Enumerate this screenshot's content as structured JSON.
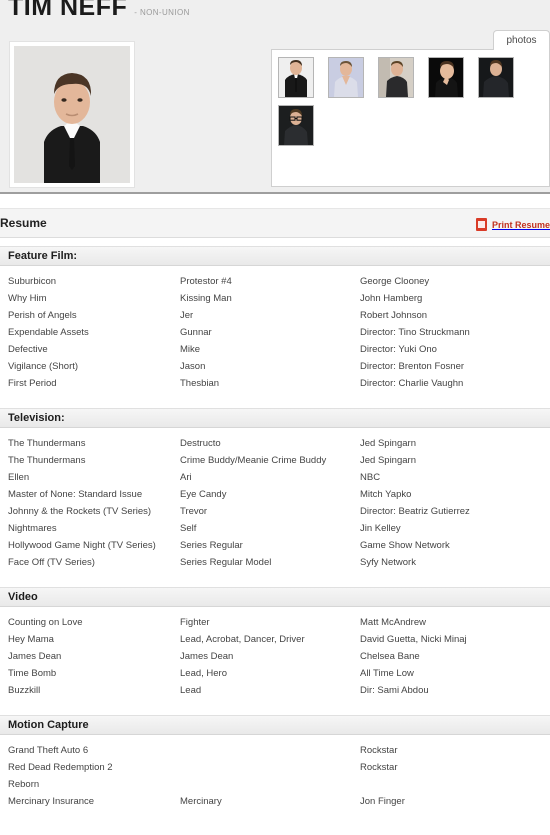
{
  "header": {
    "actor_name": "TIM NEFF",
    "union_status": "- NON-UNION",
    "headshot_alt": "headshot-photo",
    "photos_tab_label": "photos",
    "thumbnails_row1": [
      "thumb-suit",
      "thumb-vneck",
      "thumb-outdoor",
      "thumb-dark",
      "thumb-profile"
    ],
    "thumbnails_row2": [
      "thumb-glasses"
    ]
  },
  "resume_bar": {
    "title": "Resume",
    "print_label": "Print Resume",
    "pdf_icon": "pdf-icon"
  },
  "sections": [
    {
      "title": "Feature Film:",
      "rows": [
        {
          "title": "Suburbicon",
          "role": "Protestor #4",
          "extra": "George Clooney"
        },
        {
          "title": "Why Him",
          "role": "Kissing Man",
          "extra": "John Hamberg"
        },
        {
          "title": "Perish of Angels",
          "role": "Jer",
          "extra": "Robert Johnson"
        },
        {
          "title": "Expendable Assets",
          "role": "Gunnar",
          "extra": "Director: Tino Struckmann"
        },
        {
          "title": "Defective",
          "role": "Mike",
          "extra": "Director: Yuki Ono"
        },
        {
          "title": "Vigilance (Short)",
          "role": "Jason",
          "extra": "Director: Brenton Fosner"
        },
        {
          "title": "First Period",
          "role": "Thesbian",
          "extra": "Director: Charlie Vaughn"
        }
      ]
    },
    {
      "title": "Television:",
      "rows": [
        {
          "title": "The Thundermans",
          "role": "Destructo",
          "extra": "Jed Spingarn"
        },
        {
          "title": "The Thundermans",
          "role": "Crime Buddy/Meanie Crime Buddy",
          "extra": "Jed Spingarn"
        },
        {
          "title": "Ellen",
          "role": "Ari",
          "extra": "NBC"
        },
        {
          "title": "Master of None: Standard Issue",
          "role": "Eye Candy",
          "extra": "Mitch Yapko"
        },
        {
          "title": "Johnny & the Rockets (TV Series)",
          "role": "Trevor",
          "extra": "Director: Beatriz Gutierrez"
        },
        {
          "title": "Nightmares",
          "role": "Self",
          "extra": "Jin Kelley"
        },
        {
          "title": "Hollywood Game Night (TV Series)",
          "role": "Series Regular",
          "extra": "Game Show Network"
        },
        {
          "title": "Face Off (TV Series)",
          "role": "Series Regular Model",
          "extra": "Syfy Network"
        }
      ]
    },
    {
      "title": "Video",
      "rows": [
        {
          "title": "Counting on Love",
          "role": "Fighter",
          "extra": "Matt McAndrew"
        },
        {
          "title": "Hey Mama",
          "role": "Lead, Acrobat, Dancer, Driver",
          "extra": "David Guetta, Nicki Minaj"
        },
        {
          "title": "James Dean",
          "role": "James Dean",
          "extra": "Chelsea Bane"
        },
        {
          "title": "Time Bomb",
          "role": "Lead, Hero",
          "extra": "All Time Low"
        },
        {
          "title": "Buzzkill",
          "role": "Lead",
          "extra": "Dir: Sami Abdou"
        }
      ]
    },
    {
      "title": "Motion Capture",
      "rows": [
        {
          "title": "Grand Theft Auto 6",
          "role": "",
          "extra": "Rockstar"
        },
        {
          "title": "Red Dead Redemption 2",
          "role": "",
          "extra": "Rockstar"
        },
        {
          "title": "Reborn",
          "role": "",
          "extra": ""
        },
        {
          "title": "Mercinary Insurance",
          "role": "Mercinary",
          "extra": "Jon Finger"
        }
      ]
    }
  ],
  "colors": {
    "header_bg": "#efefef",
    "accent_red": "#c2311f",
    "section_header_bg": "#eeeeee",
    "text": "#444444"
  }
}
